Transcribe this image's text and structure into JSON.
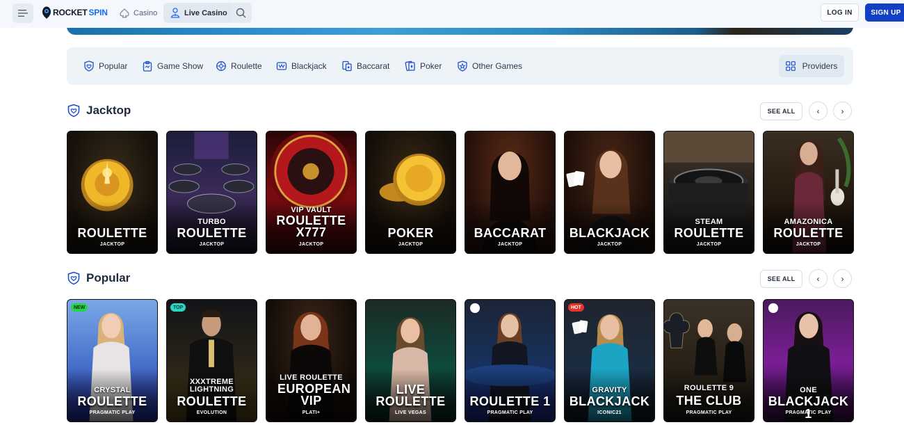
{
  "header": {
    "logo_part1": "ROCKET",
    "logo_part2": "SPIN",
    "nav": [
      {
        "label": "Casino",
        "icon": "spade-icon"
      },
      {
        "label": "Live Casino",
        "icon": "dealer-icon",
        "active": true
      }
    ],
    "search_icon": "search-icon",
    "login_label": "LOG IN",
    "signup_label": "SIGN UP",
    "accent": "#1240c4"
  },
  "categories": {
    "items": [
      {
        "label": "Popular",
        "icon": "heart-shield-icon"
      },
      {
        "label": "Game Show",
        "icon": "clipboard-icon"
      },
      {
        "label": "Roulette",
        "icon": "roulette-icon"
      },
      {
        "label": "Blackjack",
        "icon": "cards-icon"
      },
      {
        "label": "Baccarat",
        "icon": "baccarat-icon"
      },
      {
        "label": "Poker",
        "icon": "poker-icon"
      },
      {
        "label": "Other Games",
        "icon": "shield-star-icon"
      }
    ],
    "providers_label": "Providers"
  },
  "sections": [
    {
      "title": "Jacktop",
      "see_all": "SEE ALL",
      "games": [
        {
          "sub": "",
          "main": "ROULETTE",
          "provider": "JACKTOP"
        },
        {
          "sub": "TURBO",
          "main": "ROULETTE",
          "provider": "JACKTOP"
        },
        {
          "sub": "VIP VAULT",
          "main": "ROULETTE X777",
          "provider": "JACKTOP"
        },
        {
          "sub": "",
          "main": "POKER",
          "provider": "JACKTOP"
        },
        {
          "sub": "",
          "main": "BACCARAT",
          "provider": "JACKTOP"
        },
        {
          "sub": "",
          "main": "BLACKJACK",
          "provider": "JACKTOP"
        },
        {
          "sub": "STEAM",
          "main": "ROULETTE",
          "provider": "JACKTOP"
        },
        {
          "sub": "AMAZONICA",
          "main": "ROULETTE",
          "provider": "JACKTOP"
        }
      ]
    },
    {
      "title": "Popular",
      "see_all": "SEE ALL",
      "games": [
        {
          "sub": "CRYSTAL",
          "main": "ROULETTE",
          "provider": "PRAGMATIC PLAY",
          "badge": "NEW"
        },
        {
          "sub": "XXXTREME LIGHTNING",
          "main": "ROULETTE",
          "provider": "EVOLUTION",
          "badge": "TOP"
        },
        {
          "sub": "LIVE ROULETTE",
          "main": "EUROPEAN VIP",
          "provider": "PLATI+"
        },
        {
          "sub": "LIVE",
          "main": "ROULETTE",
          "provider": "LIVE VEGAS"
        },
        {
          "sub": "",
          "main": "ROULETTE 1",
          "provider": "PRAGMATIC PLAY"
        },
        {
          "sub": "GRAVITY",
          "main": "BLACKJACK",
          "provider": "ICONIC21",
          "badge": "HOT"
        },
        {
          "sub": "ROULETTE 9",
          "main": "THE CLUB",
          "provider": "PRAGMATIC PLAY"
        },
        {
          "sub": "ONE",
          "main": "BLACKJACK 1",
          "provider": "PRAGMATIC PLAY"
        }
      ]
    }
  ]
}
